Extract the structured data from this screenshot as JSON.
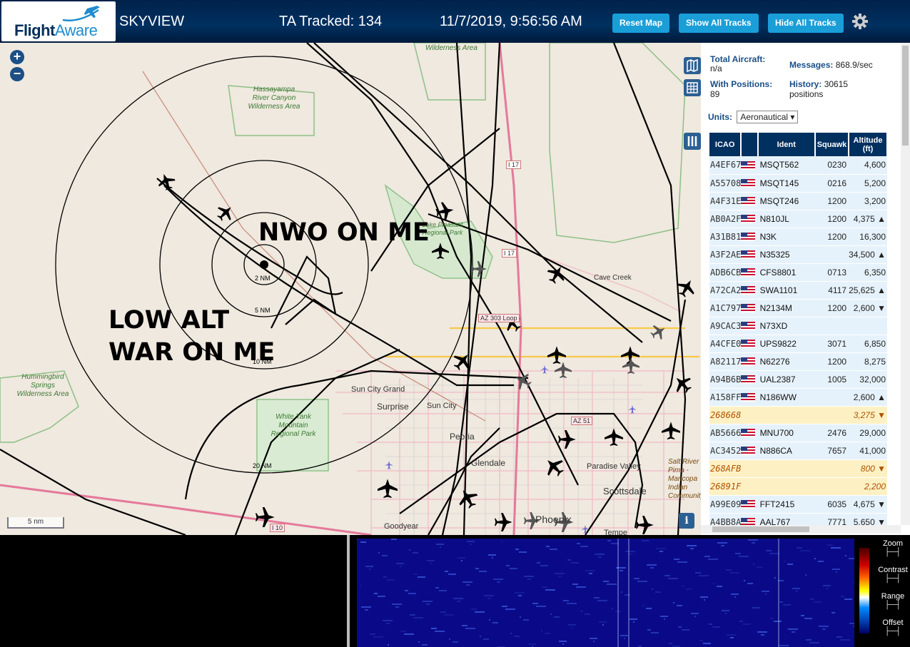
{
  "header": {
    "app": "SKYVIEW",
    "tracked": "TA Tracked: 134",
    "datetime": "11/7/2019, 9:56:56 AM",
    "buttons": {
      "reset": "Reset Map",
      "show": "Show All Tracks",
      "hide": "Hide All Tracks"
    },
    "logo_text_a": "Flight",
    "logo_text_b": "Aware"
  },
  "map": {
    "annotations": [
      "NWO ON ME",
      "LOW ALT",
      "WAR ON ME"
    ],
    "range_labels": [
      "2 NM",
      "5 NM",
      "10 NM",
      "20 NM"
    ],
    "places": [
      "Wilderness Area",
      "Hassayampa River Canyon Wilderness Area",
      "Lake Pleasant Regional Park",
      "Hummingbird Springs Wilderness Area",
      "White Tank Mountain Regional Park",
      "Sun City Grand",
      "Surprise",
      "Sun City",
      "Peoria",
      "Glendale",
      "Paradise Valley",
      "Scottsdale",
      "Cave Creek",
      "Salt River Pima - Maricopa Indian Community",
      "Goodyear",
      "Phoenix",
      "Tempe"
    ],
    "roads": [
      "I 17",
      "I 17",
      "AZ 303 Loop",
      "AZ 51",
      "I 10"
    ],
    "scale": "5 nm",
    "info": "i"
  },
  "stats": {
    "total_label": "Total Aircraft:",
    "total": "n/a",
    "pos_label": "With Positions:",
    "pos": "89",
    "msg_label": "Messages:",
    "msg": "868.9/sec",
    "hist_label": "History:",
    "hist": "30615 positions",
    "units_label": "Units:",
    "units": "Aeronautical"
  },
  "table": {
    "headers": [
      "ICAO",
      "",
      "Ident",
      "Squawk",
      "Altitude (ft)"
    ],
    "rows": [
      {
        "icao": "A4EF67",
        "flag": true,
        "ident": "MSQT562",
        "sq": "0230",
        "alt": "4,600"
      },
      {
        "icao": "A55708",
        "flag": true,
        "ident": "MSQT145",
        "sq": "0216",
        "alt": "5,200"
      },
      {
        "icao": "A4F31E",
        "flag": true,
        "ident": "MSQT246",
        "sq": "1200",
        "alt": "3,200"
      },
      {
        "icao": "AB0A2F",
        "flag": true,
        "ident": "N810JL",
        "sq": "1200",
        "alt": "4,375 ▲"
      },
      {
        "icao": "A31B81",
        "flag": true,
        "ident": "N3K",
        "sq": "1200",
        "alt": "16,300"
      },
      {
        "icao": "A3F2AE",
        "flag": true,
        "ident": "N35325",
        "sq": "",
        "alt": "34,500 ▲"
      },
      {
        "icao": "ADB6CB",
        "flag": true,
        "ident": "CFS8801",
        "sq": "0713",
        "alt": "6,350"
      },
      {
        "icao": "A72CA2",
        "flag": true,
        "ident": "SWA1101",
        "sq": "4117",
        "alt": "25,625 ▲"
      },
      {
        "icao": "A1C797",
        "flag": true,
        "ident": "N2134M",
        "sq": "1200",
        "alt": "2,600 ▼"
      },
      {
        "icao": "A9CAC3",
        "flag": true,
        "ident": "N73XD",
        "sq": "",
        "alt": ""
      },
      {
        "icao": "A4CFE0",
        "flag": true,
        "ident": "UPS9822",
        "sq": "3071",
        "alt": "6,850"
      },
      {
        "icao": "A82117",
        "flag": true,
        "ident": "N62276",
        "sq": "1200",
        "alt": "8,275"
      },
      {
        "icao": "A94B6B",
        "flag": true,
        "ident": "UAL2387",
        "sq": "1005",
        "alt": "32,000"
      },
      {
        "icao": "A158FF",
        "flag": true,
        "ident": "N186WW",
        "sq": "",
        "alt": "2,600 ▲"
      },
      {
        "icao": "268668",
        "flag": false,
        "ident": "",
        "sq": "",
        "alt": "3,275 ▼",
        "y": true
      },
      {
        "icao": "AB5666",
        "flag": true,
        "ident": "MNU700",
        "sq": "2476",
        "alt": "29,000"
      },
      {
        "icao": "AC3452",
        "flag": true,
        "ident": "N886CA",
        "sq": "7657",
        "alt": "41,000"
      },
      {
        "icao": "268AFB",
        "flag": false,
        "ident": "",
        "sq": "",
        "alt": "800 ▼",
        "y": true
      },
      {
        "icao": "26891F",
        "flag": false,
        "ident": "",
        "sq": "",
        "alt": "2,200",
        "y": true
      },
      {
        "icao": "A99E09",
        "flag": true,
        "ident": "FFT2415",
        "sq": "6035",
        "alt": "4,675 ▼"
      },
      {
        "icao": "A4BB8A",
        "flag": true,
        "ident": "AAL767",
        "sq": "7771",
        "alt": "5,650 ▼"
      }
    ]
  },
  "spectrum": {
    "controls": [
      "Zoom",
      "Contrast",
      "Range",
      "Offset"
    ]
  }
}
